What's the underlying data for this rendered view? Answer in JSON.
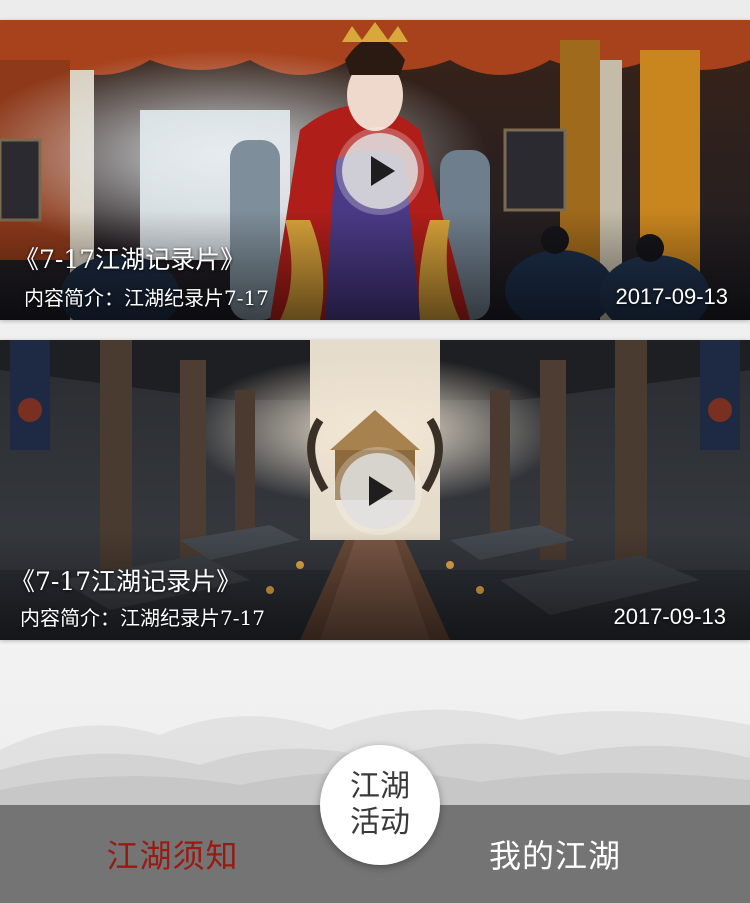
{
  "videos": [
    {
      "title": "《7-17江湖记录片》",
      "description": "内容简介：江湖纪录片7-17",
      "date": "2017-09-13"
    },
    {
      "title": "《7-17江湖记录片》",
      "description": "内容简介：江湖纪录片7-17",
      "date": "2017-09-13"
    }
  ],
  "center_button": {
    "line1": "江湖",
    "line2": "活动"
  },
  "footer": {
    "left_label": "江湖须知",
    "right_label": "我的江湖"
  },
  "colors": {
    "footer_bg": "#747474",
    "left_label": "#9a1a12",
    "right_label": "#ffffff"
  },
  "icons": {
    "play": "play-icon"
  }
}
